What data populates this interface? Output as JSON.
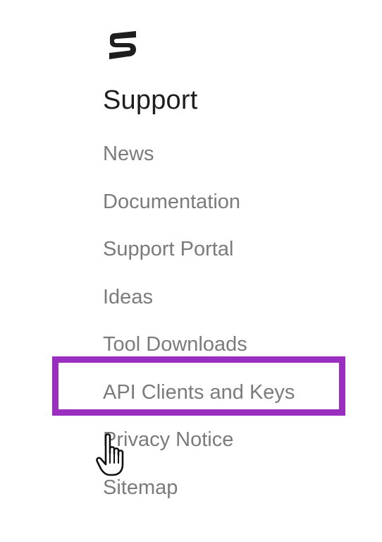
{
  "footer": {
    "logo_icon": "brand-logo-icon",
    "section_title": "Support",
    "links": [
      {
        "label": "News"
      },
      {
        "label": "Documentation"
      },
      {
        "label": "Support Portal"
      },
      {
        "label": "Ideas"
      },
      {
        "label": "Tool Downloads"
      },
      {
        "label": "API Clients and Keys"
      },
      {
        "label": "Privacy Notice"
      },
      {
        "label": "Sitemap"
      }
    ]
  },
  "annotation": {
    "highlighted_item": "API Clients and Keys",
    "highlight_color": "#9a2fbf"
  },
  "cursor": {
    "icon": "hand-pointer-icon"
  }
}
